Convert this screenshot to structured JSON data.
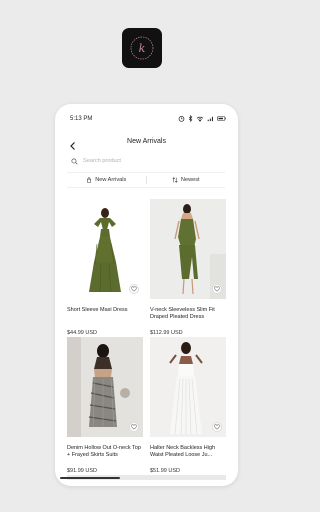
{
  "status_bar": {
    "time": "5:13 PM"
  },
  "header": {
    "title": "New Arrivals"
  },
  "search": {
    "placeholder": "Search product"
  },
  "filters": {
    "category_label": "New Arrivals",
    "sort_label": "Newest"
  },
  "products": [
    {
      "name": "Short Sleeve Maxi Dress",
      "price": "$44.99 USD"
    },
    {
      "name": "V-neck Sleeveless Slim Fit Draped Pleated Dress",
      "price": "$112.99 USD"
    },
    {
      "name": "Denim Hollow Out O-neck Top + Frayed Skirts Suits",
      "price": "$91.99 USD"
    },
    {
      "name": "Halter Neck Backless High Waist Pleated Loose Ju...",
      "price": "$51.99 USD"
    }
  ],
  "colors": {
    "background": "#ebebeb",
    "dress_green": "#5c6b2e",
    "logo_bg": "#111111",
    "logo_accent": "#c98a9a"
  },
  "icons": [
    "app-logo",
    "back-arrow-icon",
    "search-icon",
    "shop-bag-icon",
    "sort-icon",
    "heart-icon"
  ]
}
